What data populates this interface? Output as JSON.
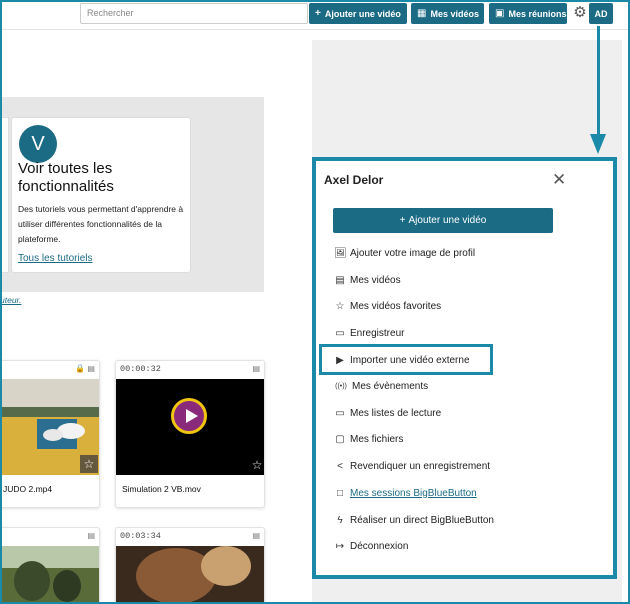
{
  "topbar": {
    "search_placeholder": "Rechercher",
    "add_video": "Ajouter une vidéo",
    "add_video_icon": "+",
    "my_videos": "Mes vidéos",
    "my_videos_icon": "▦",
    "my_meetings": "Mes réunions",
    "my_meetings_icon": "▣",
    "settings_icon": "⚙",
    "avatar_initials": "AD"
  },
  "tutorial_card": {
    "avatar_letter": "V",
    "title": "Voir toutes les fonctionnalités",
    "description": "Des tutoriels vous permettant d'apprendre à utiliser différentes fonctionnalités de la plateforme.",
    "link": "Tous les tutoriels"
  },
  "fragment_link": "uteur.",
  "videos": [
    {
      "duration": "",
      "icons": "🔒 ▤",
      "title": "JUDO 2.mp4"
    },
    {
      "duration": "00:00:32",
      "icons": "▤",
      "title": "Simulation 2 VB.mov"
    },
    {
      "duration": "",
      "icons": "▤",
      "title": ""
    },
    {
      "duration": "00:03:34",
      "icons": "▤",
      "title": ""
    }
  ],
  "star_icon": "☆",
  "panel": {
    "user_name": "Axel Delor",
    "close_icon": "✕",
    "add_video_icon": "+",
    "add_video": "Ajouter une vidéo",
    "items": [
      {
        "icon": "🖼",
        "label": "Ajouter votre image de profil"
      },
      {
        "icon": "▤",
        "label": "Mes vidéos"
      },
      {
        "icon": "☆",
        "label": "Mes vidéos favorites"
      },
      {
        "icon": "▭",
        "label": "Enregistreur"
      },
      {
        "icon": "▶",
        "label": "Importer une vidéo externe"
      },
      {
        "icon": "((•))",
        "label": "Mes évènements"
      },
      {
        "icon": "▭",
        "label": "Mes listes de lecture"
      },
      {
        "icon": "▢",
        "label": "Mes fichiers"
      },
      {
        "icon": "<",
        "label": "Revendiquer un enregistrement"
      },
      {
        "icon": "□",
        "label": "Mes sessions BigBlueButton"
      },
      {
        "icon": "ϟ",
        "label": "Réaliser un direct BigBlueButton"
      },
      {
        "icon": "↦",
        "label": "Déconnexion"
      }
    ]
  },
  "colors": {
    "accent": "#1b6b84",
    "annotation": "#1a8aa8"
  }
}
